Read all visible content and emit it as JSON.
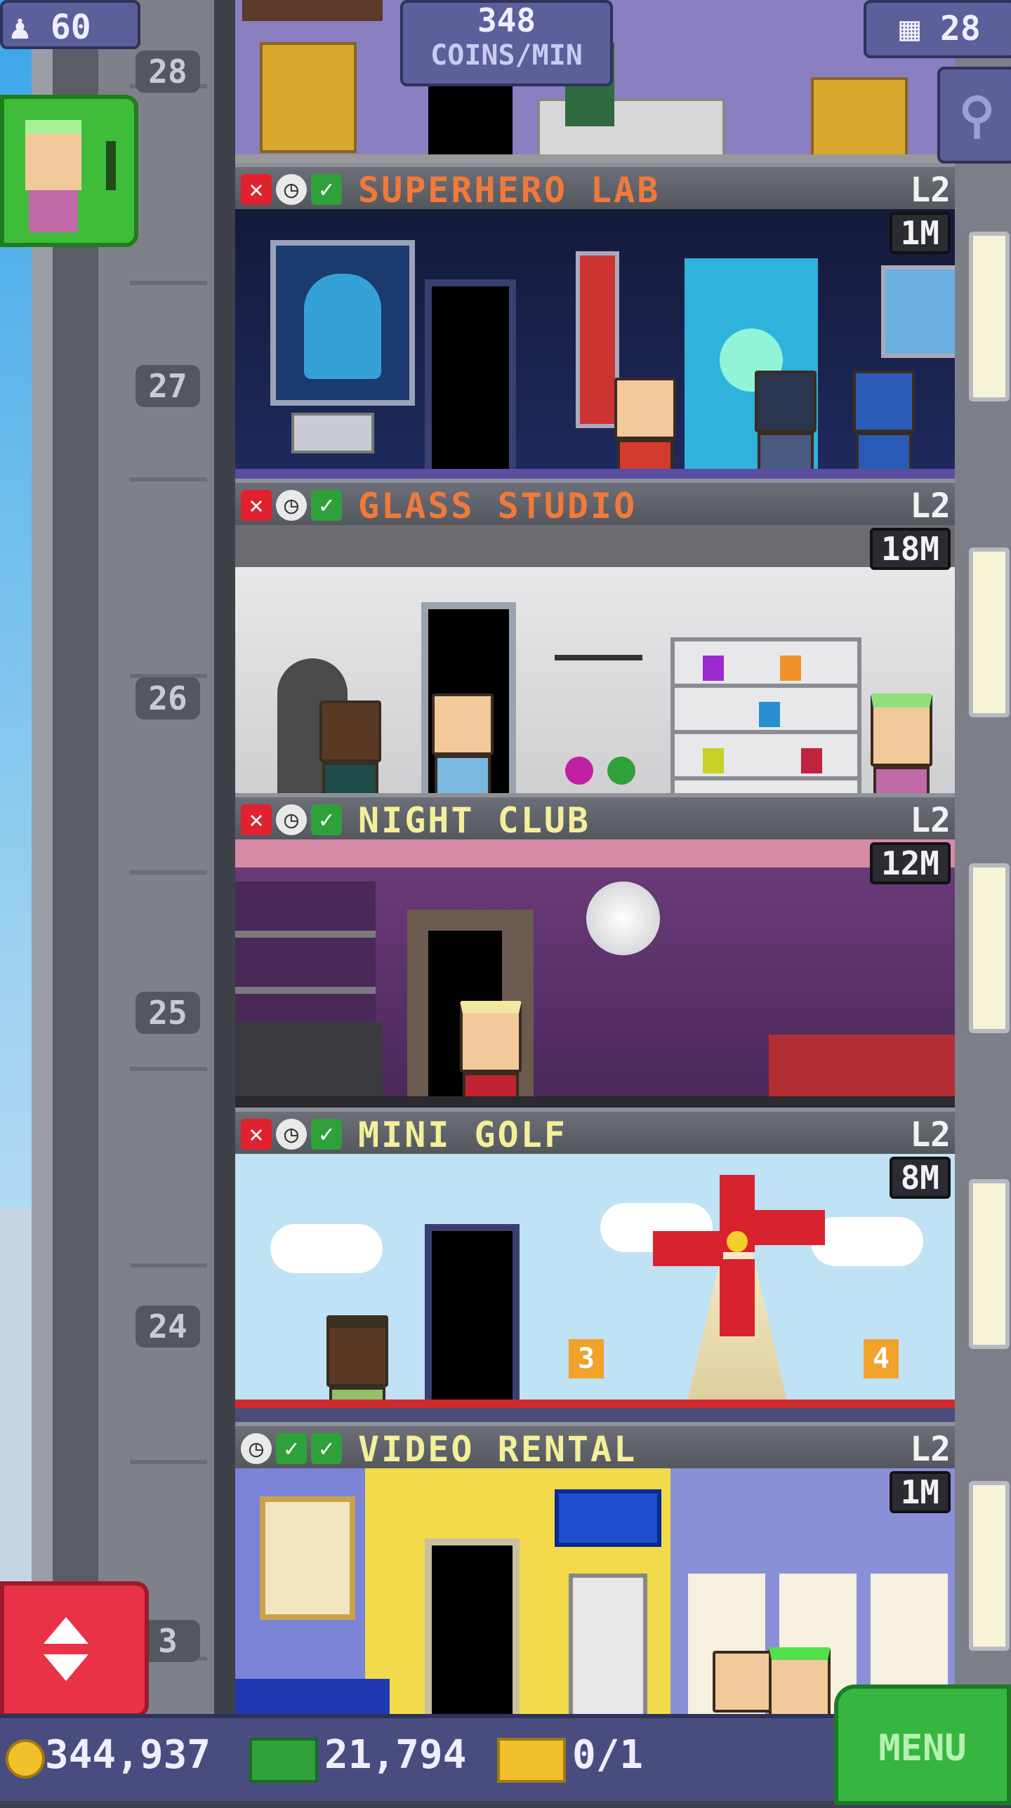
{
  "hud": {
    "population": "60",
    "coins_rate_value": "348",
    "coins_rate_unit": "COINS/MIN",
    "floors": "28"
  },
  "shaft": {
    "floor_numbers": [
      "28",
      "27",
      "26",
      "25",
      "24",
      "3"
    ]
  },
  "floors": [
    {
      "name": "SUPERHERO LAB",
      "level": "L2",
      "prize": "1M",
      "color": "#f07a3a",
      "status": [
        "x",
        "clock",
        "check"
      ]
    },
    {
      "name": "GLASS STUDIO",
      "level": "L2",
      "prize": "18M",
      "color": "#f07a3a",
      "status": [
        "x",
        "clock",
        "check"
      ]
    },
    {
      "name": "NIGHT CLUB",
      "level": "L2",
      "prize": "12M",
      "color": "#f4ef9a",
      "status": [
        "x",
        "clock",
        "check"
      ]
    },
    {
      "name": "MINI GOLF",
      "level": "L2",
      "prize": "8M",
      "color": "#f4ef9a",
      "status": [
        "x",
        "clock",
        "check"
      ]
    },
    {
      "name": "VIDEO RENTAL",
      "level": "L2",
      "prize": "1M",
      "color": "#f4ef9a",
      "status": [
        "clock",
        "check",
        "check"
      ]
    }
  ],
  "bottom": {
    "coins": "344,937",
    "bux": "21,794",
    "tickets": "0/1",
    "menu_label": "MENU"
  },
  "minigolf_signs": [
    "3",
    "4"
  ],
  "colors": {
    "accent_orange": "#f07a3a",
    "accent_yellow": "#f4ef9a",
    "menu_green": "#36b640",
    "elevator_red": "#e93247"
  }
}
